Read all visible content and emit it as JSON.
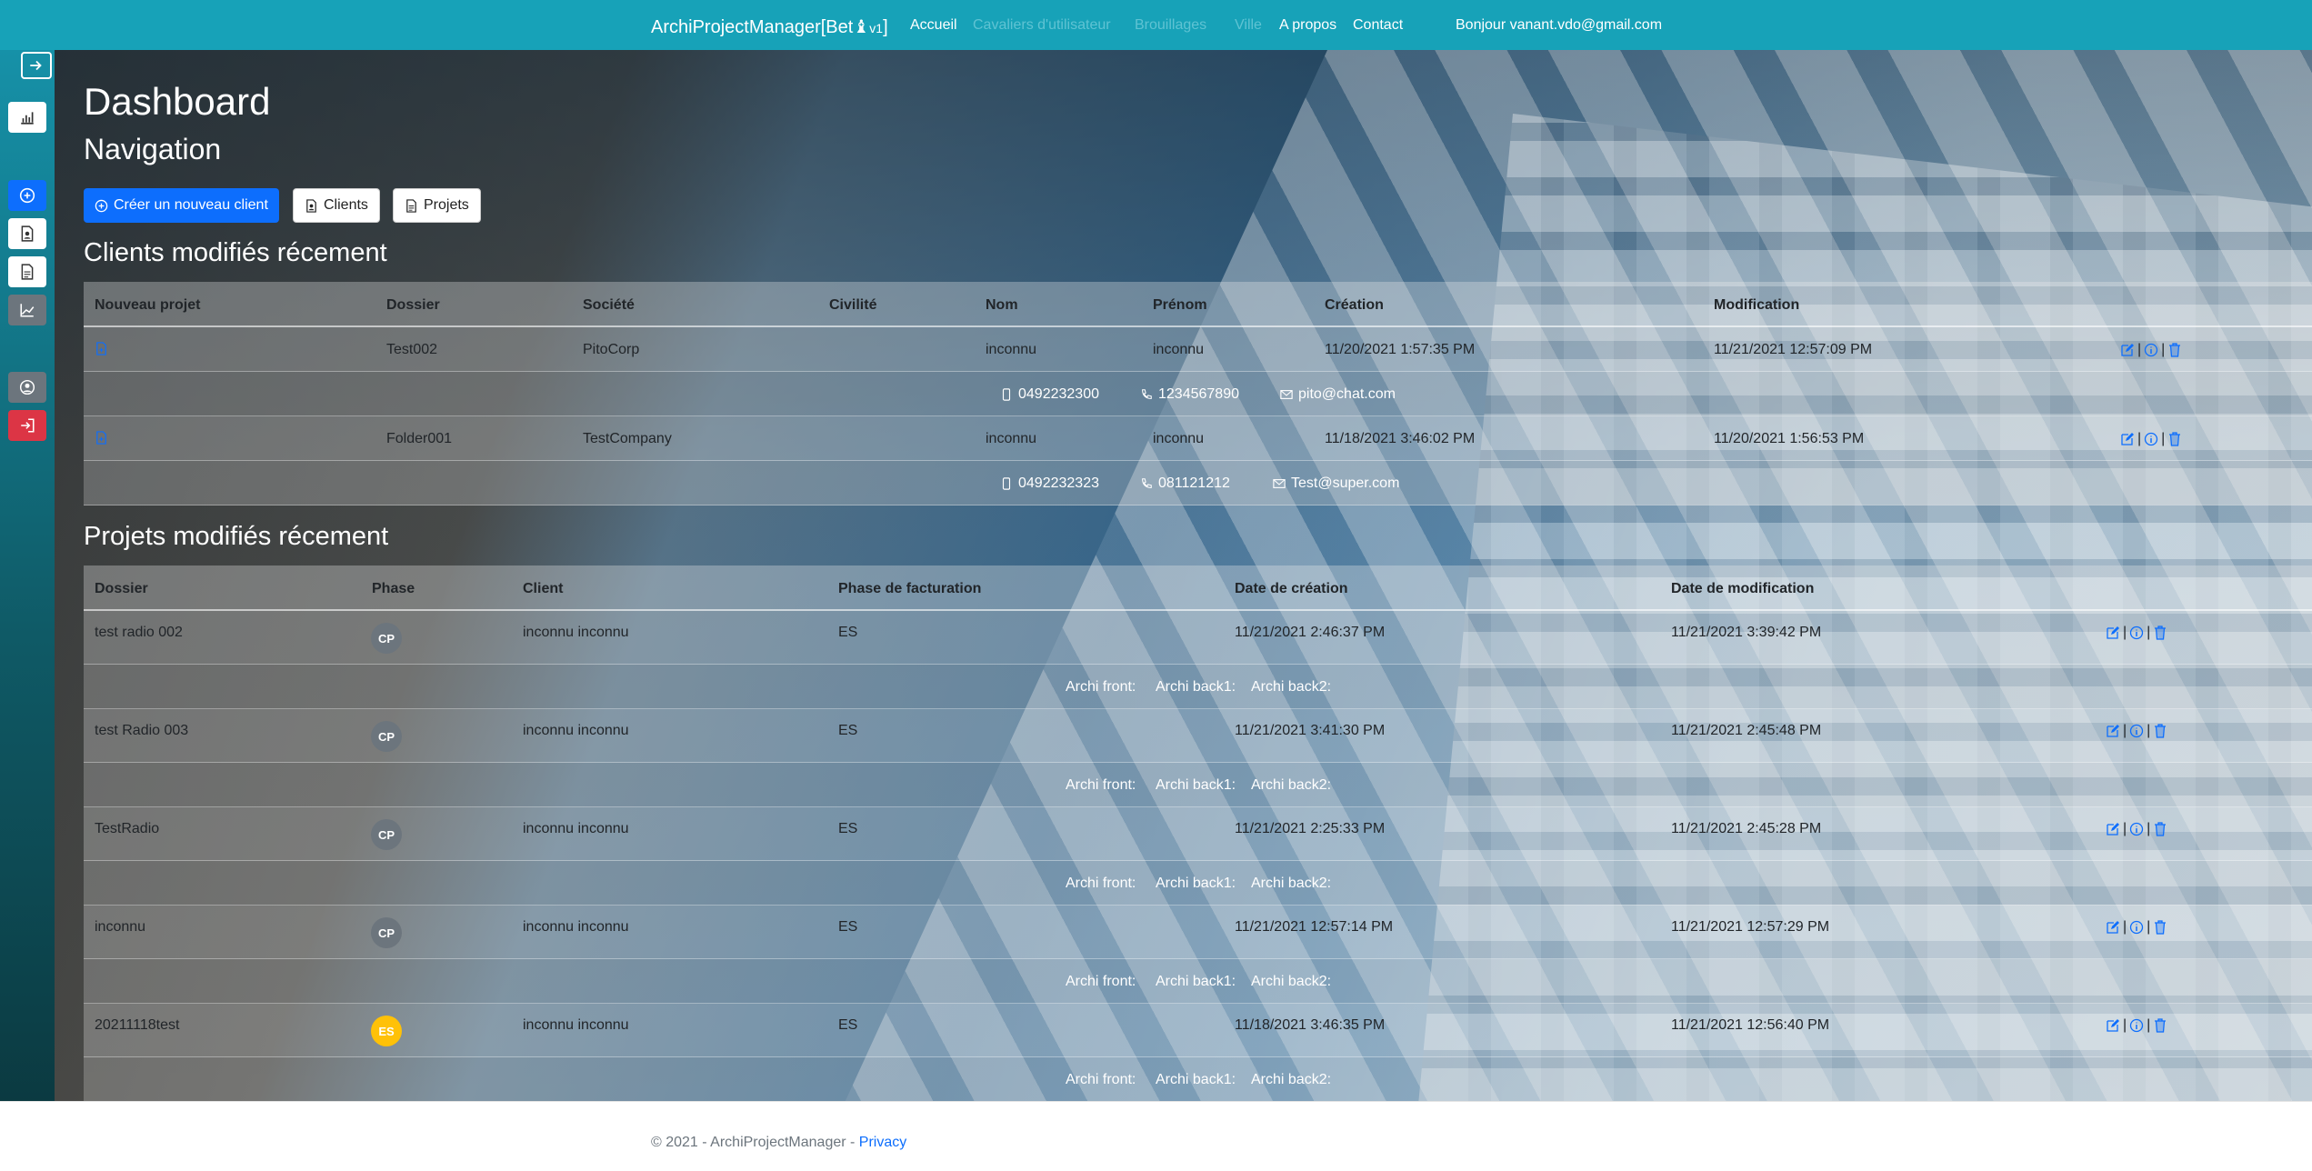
{
  "navbar": {
    "brand": "ArchiProjectManager[Bet",
    "brand_icon": "♝",
    "brand_version": "v1",
    "brand_close": "]",
    "links": [
      "Accueil",
      "Cavaliers d'utilisateur",
      "Brouillages",
      "Ville",
      "A propos",
      "Contact"
    ],
    "greeting": "Bonjour vanant.vdo@gmail.com",
    "color": "#17a2b8"
  },
  "sidebar": {
    "items": [
      "collapse-toggle",
      "chart-bar",
      "add-circle",
      "client-file",
      "project-file",
      "graph",
      "user",
      "logout"
    ]
  },
  "page": {
    "title": "Dashboard",
    "subtitle": "Navigation"
  },
  "buttons": {
    "create_client": "Créer un nouveau client",
    "clients": "Clients",
    "projects": "Projets"
  },
  "clients": {
    "title": "Clients modifiés récement",
    "columns": [
      "Nouveau projet",
      "Dossier",
      "Société",
      "Civilité",
      "Nom",
      "Prénom",
      "Création",
      "Modification"
    ],
    "rows": [
      {
        "dossier": "Test002",
        "societe": "PitoCorp",
        "civilite": "",
        "nom": "inconnu",
        "prenom": "inconnu",
        "creation": "11/20/2021 1:57:35 PM",
        "modification": "11/21/2021 12:57:09 PM",
        "mobile": "0492232300",
        "phone": "1234567890",
        "email": "pito@chat.com"
      },
      {
        "dossier": "Folder001",
        "societe": "TestCompany",
        "civilite": "",
        "nom": "inconnu",
        "prenom": "inconnu",
        "creation": "11/18/2021 3:46:02 PM",
        "modification": "11/20/2021 1:56:53 PM",
        "mobile": "0492232323",
        "phone": "081121212",
        "email": "Test@super.com"
      }
    ]
  },
  "projects": {
    "title": "Projets modifiés récement",
    "columns": [
      "Dossier",
      "Phase",
      "Client",
      "Phase de facturation",
      "Date de création",
      "Date de modification"
    ],
    "sub_labels": [
      "Archi front:",
      "Archi back1:",
      "Archi back2:"
    ],
    "rows": [
      {
        "dossier": "test radio 002",
        "phase": "CP",
        "client": "inconnu inconnu",
        "facturation": "ES",
        "creation": "11/21/2021 2:46:37 PM",
        "modification": "11/21/2021 3:39:42 PM"
      },
      {
        "dossier": "test Radio 003",
        "phase": "CP",
        "client": "inconnu inconnu",
        "facturation": "ES",
        "creation": "11/21/2021 3:41:30 PM",
        "modification": "11/21/2021 2:45:48 PM"
      },
      {
        "dossier": "TestRadio",
        "phase": "CP",
        "client": "inconnu inconnu",
        "facturation": "ES",
        "creation": "11/21/2021 2:25:33 PM",
        "modification": "11/21/2021 2:45:28 PM"
      },
      {
        "dossier": "inconnu",
        "phase": "CP",
        "client": "inconnu inconnu",
        "facturation": "ES",
        "creation": "11/21/2021 12:57:14 PM",
        "modification": "11/21/2021 12:57:29 PM"
      },
      {
        "dossier": "20211118test",
        "phase": "ES",
        "client": "inconnu inconnu",
        "facturation": "ES",
        "creation": "11/18/2021 3:46:35 PM",
        "modification": "11/21/2021 12:56:40 PM"
      }
    ]
  },
  "footer": {
    "text": "© 2021 - ArchiProjectManager - ",
    "privacy": "Privacy"
  },
  "colors": {
    "primary": "#0d6efd",
    "phase_cp": "#6c757d",
    "phase_es": "#ffc107",
    "logout": "#dc3545"
  }
}
